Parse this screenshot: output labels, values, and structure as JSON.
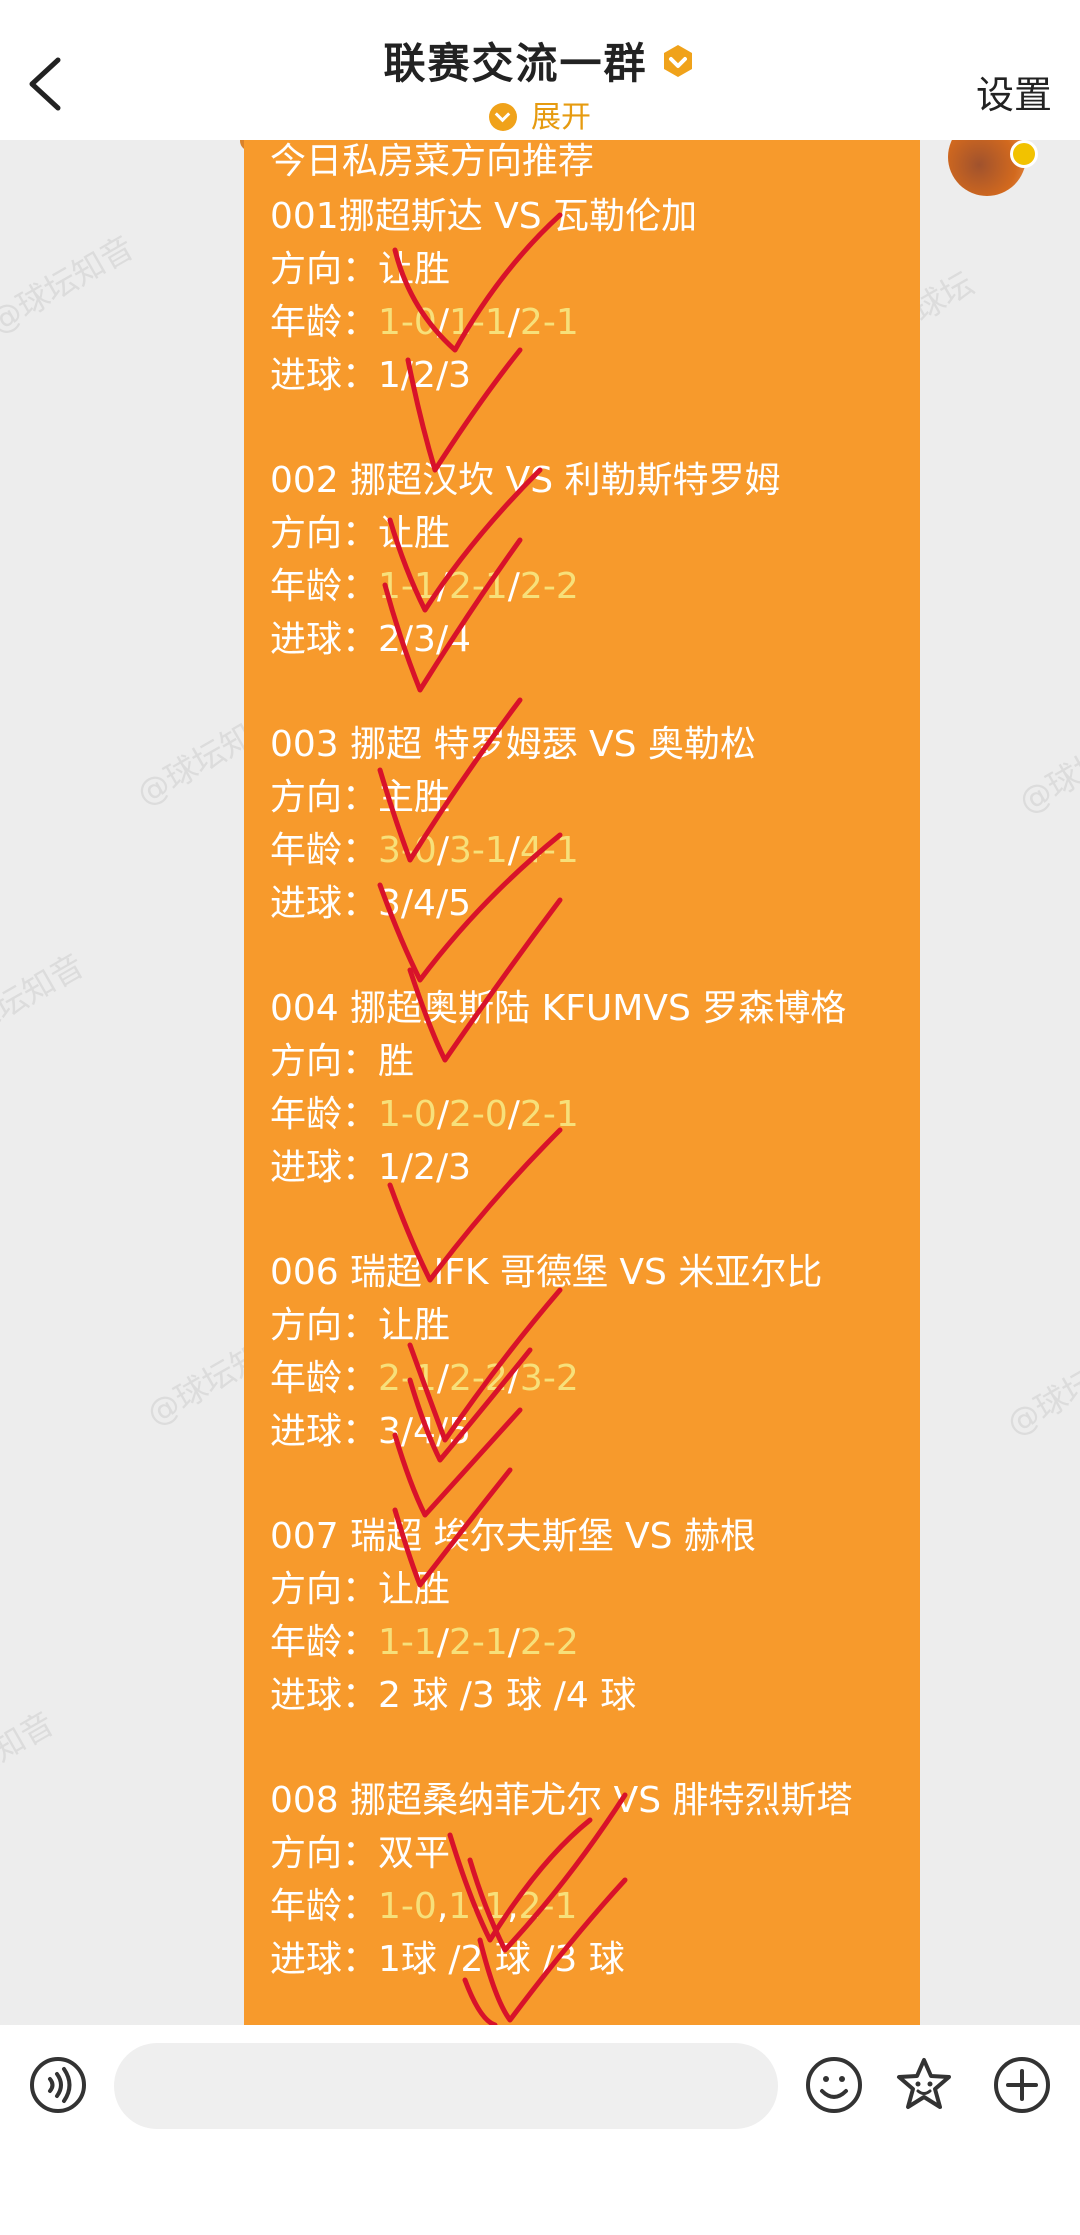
{
  "header": {
    "title": "联赛交流一群",
    "expand_label": "展开",
    "settings_label": "设置",
    "back_icon": "chevron-left-icon"
  },
  "watermarks": [
    "@球坛知音",
    "球坛知音",
    "@球坛知",
    "@球坛知音",
    "@球坛知",
    "坛知音",
    "@球坛知",
    "@球坛"
  ],
  "message": {
    "intro": "今日私房菜方向推荐",
    "direction_label": "方向：",
    "age_label": "年龄：",
    "goals_label": "进球：",
    "matches": [
      {
        "title": "001挪超斯达 VS 瓦勒伦加",
        "direction": "让胜",
        "age": [
          "1-0",
          "/",
          "1-1",
          "/",
          "2-1"
        ],
        "goals": "1/2/3"
      },
      {
        "title": "002 挪超汉坎 VS 利勒斯特罗姆",
        "direction": "让胜",
        "age": [
          "1-1",
          "/",
          "2-1",
          "/",
          "2-2"
        ],
        "goals": "2/3/4"
      },
      {
        "title": "003 挪超 特罗姆瑟 VS 奥勒松",
        "direction": "主胜",
        "age": [
          "3-0",
          "/",
          "3-1",
          "/",
          "4-1"
        ],
        "goals": "3/4/5"
      },
      {
        "title": "004 挪超奥斯陆 KFUMVS 罗森博格",
        "direction": "胜",
        "age": [
          "1-0",
          "/",
          "2-0",
          "/",
          "2-1"
        ],
        "goals": "1/2/3"
      },
      {
        "title": "006 瑞超 IFK 哥德堡 VS 米亚尔比",
        "direction": "让胜",
        "age": [
          "2-1",
          "/",
          "2-2",
          "/",
          "3-2"
        ],
        "goals": "3/4/5"
      },
      {
        "title": "007 瑞超 埃尔夫斯堡 VS 赫根",
        "direction": "让胜",
        "age": [
          "1-1",
          "/",
          "2-1",
          "/",
          "2-2"
        ],
        "goals": "2 球 /3 球 /4 球"
      },
      {
        "title": "008 挪超桑纳菲尤尔 VS 腓特烈斯塔",
        "direction": "双平",
        "age": [
          "1-0",
          ",",
          "1-1",
          ",",
          "2-1"
        ],
        "goals": "1球 /2 球 /3 球"
      }
    ]
  },
  "colors": {
    "bubble": "#f79a2c",
    "age_highlight": "#f7e07a",
    "checkmark": "#d8122a",
    "accent": "#f0a21a"
  },
  "bottom_bar": {
    "icons": [
      "voice-icon",
      "emoji-icon",
      "sticker-icon",
      "plus-icon"
    ]
  }
}
